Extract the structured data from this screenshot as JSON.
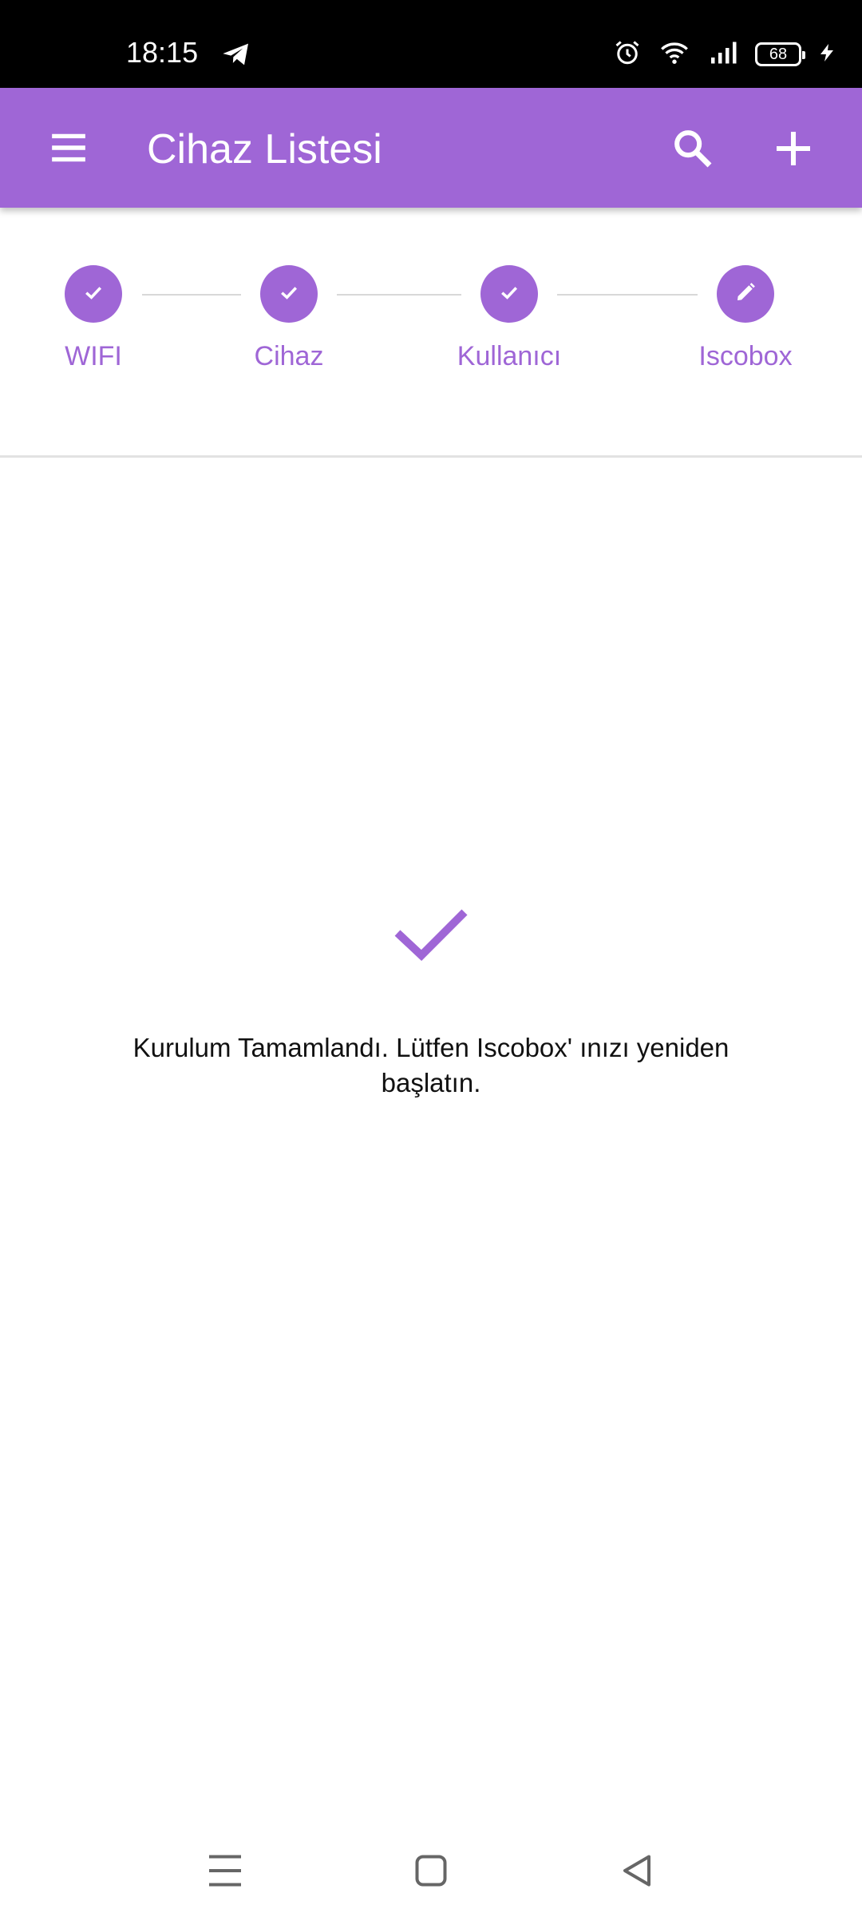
{
  "status_bar": {
    "time": "18:15",
    "battery_level": "68",
    "icons": [
      "telegram-icon",
      "alarm-icon",
      "wifi-icon",
      "signal-icon",
      "battery-icon",
      "charging-icon"
    ]
  },
  "app_bar": {
    "title": "Cihaz Listesi",
    "icons": [
      "menu-icon",
      "search-icon",
      "add-icon"
    ]
  },
  "stepper": {
    "steps": [
      {
        "label": "WIFI",
        "state": "done",
        "icon": "check-icon"
      },
      {
        "label": "Cihaz",
        "state": "done",
        "icon": "check-icon"
      },
      {
        "label": "Kullanıcı",
        "state": "done",
        "icon": "check-icon"
      },
      {
        "label": "Iscobox",
        "state": "editing",
        "icon": "edit-icon"
      }
    ]
  },
  "content": {
    "message": "Kurulum Tamamlandı. Lütfen Iscobox' ınızı yeniden başlatın.",
    "icon": "check-icon"
  },
  "nav_bar": {
    "icons": [
      "recents-icon",
      "home-icon",
      "back-icon"
    ]
  },
  "colors": {
    "accent": "#9f66d6",
    "status_bar": "#000000",
    "text": "#111111"
  }
}
